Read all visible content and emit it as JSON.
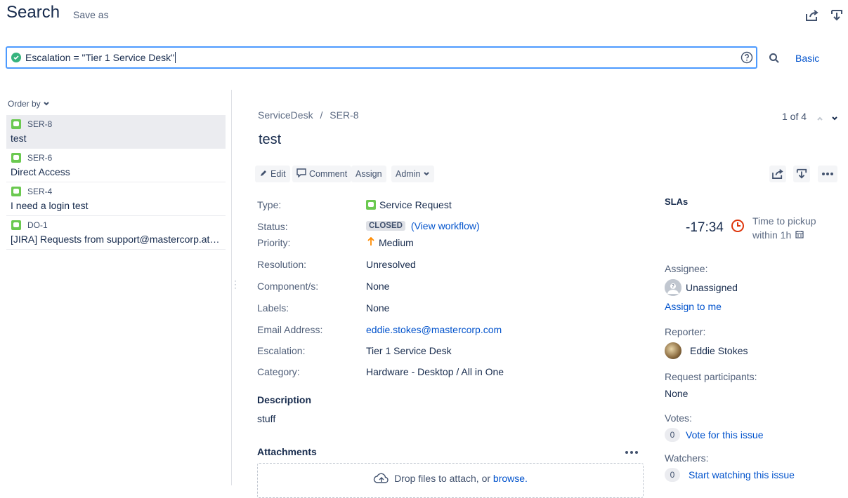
{
  "header": {
    "title": "Search",
    "save_as": "Save as"
  },
  "search": {
    "query": "Escalation = \"Tier 1 Service Desk\"",
    "search_button": "search-icon",
    "mode": "Basic"
  },
  "list": {
    "order_by": "Order by",
    "issues": [
      {
        "key": "SER-8",
        "summary": "test",
        "selected": true
      },
      {
        "key": "SER-6",
        "summary": "Direct Access"
      },
      {
        "key": "SER-4",
        "summary": "I need a login test"
      },
      {
        "key": "DO-1",
        "summary": "[JIRA] Requests from support@mastercorp.atla..."
      }
    ]
  },
  "detail": {
    "breadcrumb": {
      "project": "ServiceDesk",
      "sep": "/",
      "key": "SER-8"
    },
    "pager": "1 of 4",
    "summary": "test",
    "actions": {
      "edit": "Edit",
      "comment": "Comment",
      "assign": "Assign",
      "admin": "Admin"
    },
    "fields": {
      "type_label": "Type:",
      "type_value": "Service Request",
      "status_label": "Status:",
      "status_value": "CLOSED",
      "workflow_link": "(View workflow)",
      "priority_label": "Priority:",
      "priority_value": "Medium",
      "resolution_label": "Resolution:",
      "resolution_value": "Unresolved",
      "components_label": "Component/s:",
      "components_value": "None",
      "labels_label": "Labels:",
      "labels_value": "None",
      "email_label": "Email Address:",
      "email_value": "eddie.stokes@mastercorp.com",
      "escalation_label": "Escalation:",
      "escalation_value": "Tier 1 Service Desk",
      "category_label": "Category:",
      "category_value": "Hardware - Desktop / All in One"
    },
    "description": {
      "title": "Description",
      "text": "stuff"
    },
    "attachments": {
      "title": "Attachments",
      "drop_text": "Drop files to attach, or",
      "browse": "browse."
    }
  },
  "sidebar": {
    "slas_title": "SLAs",
    "sla_time": "-17:34",
    "sla_name_1": "Time to pickup",
    "sla_name_2": "within 1h",
    "assignee_label": "Assignee:",
    "assignee_value": "Unassigned",
    "assign_to_me": "Assign to me",
    "reporter_label": "Reporter:",
    "reporter_value": "Eddie Stokes",
    "participants_label": "Request participants:",
    "participants_value": "None",
    "votes_label": "Votes:",
    "votes_count": "0",
    "vote_link": "Vote for this issue",
    "watchers_label": "Watchers:",
    "watchers_count": "0",
    "watch_link": "Start watching this issue"
  },
  "colors": {
    "accent": "#0052cc",
    "focus": "#4c9aff",
    "success": "#36b37e",
    "sla_breach": "#de350b",
    "priority_medium": "#ff8b00"
  }
}
